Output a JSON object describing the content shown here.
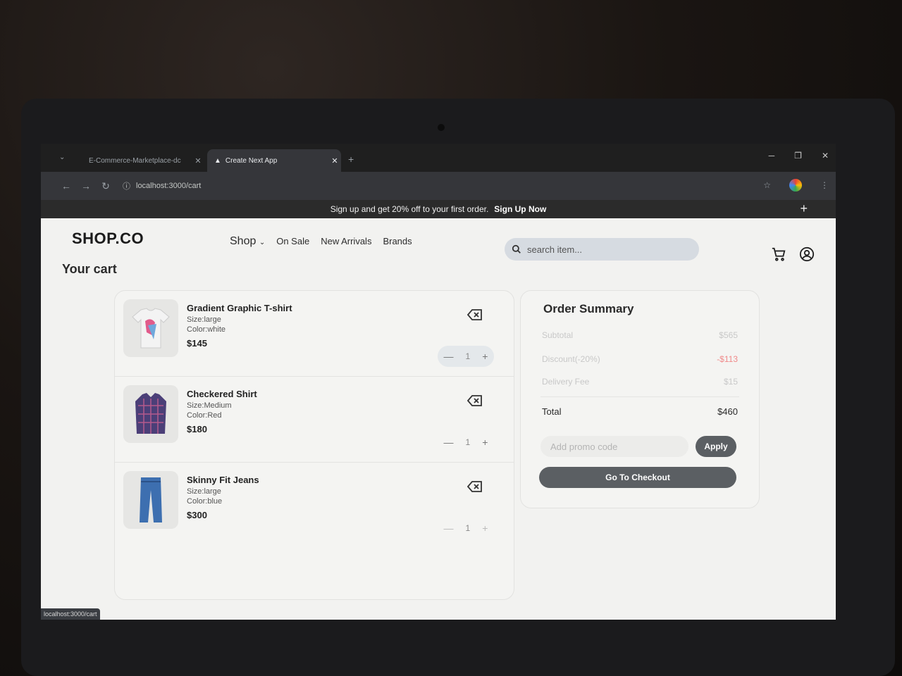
{
  "browser": {
    "tabs": [
      {
        "label": "E-Commerce-Marketplace-dc",
        "active": false
      },
      {
        "label": "Create Next App",
        "active": true
      }
    ],
    "url": "localhost:3000/cart",
    "status_url": "localhost:3000/cart"
  },
  "announcement": {
    "text": "Sign up and get 20% off to your first order.",
    "link": "Sign Up Now"
  },
  "header": {
    "logo": "SHOP.CO",
    "nav": [
      "Shop",
      "On Sale",
      "New Arrivals",
      "Brands"
    ],
    "search_placeholder": "search item..."
  },
  "page_title": "Your cart",
  "cart": {
    "items": [
      {
        "name": "Gradient Graphic T-shirt",
        "size": "Size:large",
        "color": "Color:white",
        "price": "$145",
        "qty": "1"
      },
      {
        "name": "Checkered Shirt",
        "size": "Size:Medium",
        "color": "Color:Red",
        "price": "$180",
        "qty": "1"
      },
      {
        "name": "Skinny Fit Jeans",
        "size": "Size:large",
        "color": "Color:blue",
        "price": "$300",
        "qty": "1"
      }
    ]
  },
  "summary": {
    "title": "Order Summary",
    "subtotal_label": "Subtotal",
    "subtotal_value": "$565",
    "discount_label": "Discount(-20%)",
    "discount_value": "-$113",
    "delivery_label": "Delivery Fee",
    "delivery_value": "$15",
    "total_label": "Total",
    "total_value": "$460",
    "promo_placeholder": "Add promo code",
    "apply_label": "Apply",
    "checkout_label": "Go To Checkout"
  },
  "colors": {
    "announcement_bg": "#2b2b2b",
    "button_bg": "#5b5f63",
    "discount": "#f08a8a",
    "search_bg": "#d6dbe1"
  }
}
